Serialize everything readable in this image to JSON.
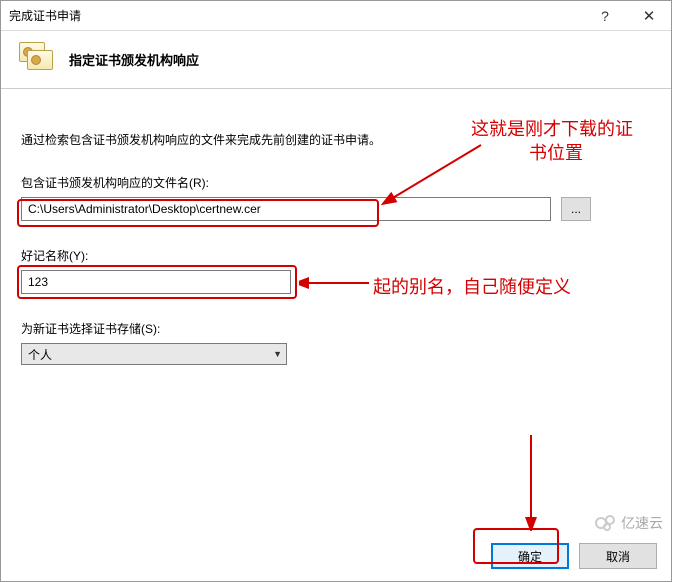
{
  "titlebar": {
    "title": "完成证书申请",
    "help_icon": "?",
    "close_icon": "✕"
  },
  "header": {
    "title": "指定证书颁发机构响应"
  },
  "content": {
    "description": "通过检索包含证书颁发机构响应的文件来完成先前创建的证书申请。",
    "file_label": "包含证书颁发机构响应的文件名(R):",
    "file_value": "C:\\Users\\Administrator\\Desktop\\certnew.cer",
    "browse_label": "...",
    "name_label": "好记名称(Y):",
    "name_value": "123",
    "store_label": "为新证书选择证书存储(S):",
    "store_value": "个人"
  },
  "buttons": {
    "ok": "确定",
    "cancel": "取消"
  },
  "annotations": {
    "a1_line1": "这就是刚才下载的证",
    "a1_line2": "书位置",
    "a2": "起的别名，自己随便定义"
  },
  "watermark": {
    "text": "亿速云"
  }
}
